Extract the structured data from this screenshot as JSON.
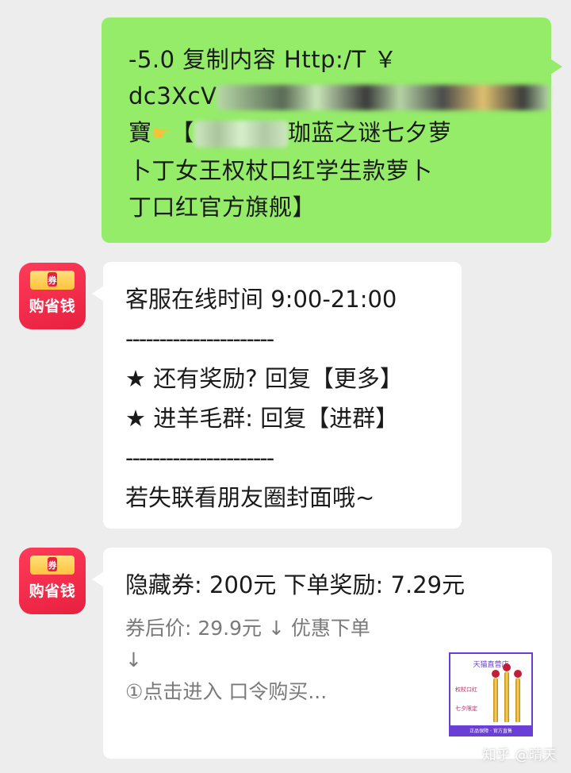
{
  "outgoing_message": {
    "line1": "-5.0 复制内容 Http:/T ￥",
    "line2_visible": "dc3XcV",
    "line3_suffix": "珈蓝之谜七夕萝",
    "line3_prefix": "寶",
    "line3_bracket": "【",
    "line4": "卜丁女王权杖口红学生款萝卜",
    "line5": "丁口红官方旗舰】"
  },
  "avatar": {
    "ticket_text": "券",
    "label": "购省钱"
  },
  "message_service": {
    "hours": "客服在线时间 9:00-21:00",
    "divider": "----------------------",
    "reward_line": "★ 还有奖励? 回复【更多】",
    "group_line": "★ 进羊毛群: 回复【进群】",
    "divider2": "----------------------",
    "contact_line": "若失联看朋友圈封面哦~"
  },
  "message_coupon": {
    "title": "隐藏券: 200元  下单奖励: 7.29元",
    "price_line": "券后价: 29.9元  ↓ 优惠下单",
    "arrow_line": "↓",
    "step_line": "①点击进入  口令购买..."
  },
  "product_thumbnail": {
    "shop_name": "天猫直营店",
    "tag1": "权杖口红",
    "tag2": "七夕限定",
    "footer": "正品保障 · 官方直售"
  },
  "watermark": "知乎 @晴天",
  "colors": {
    "outgoing_bubble": "#95ec69",
    "incoming_bubble": "#ffffff",
    "background": "#ededed",
    "avatar_red": "#e8203f"
  }
}
